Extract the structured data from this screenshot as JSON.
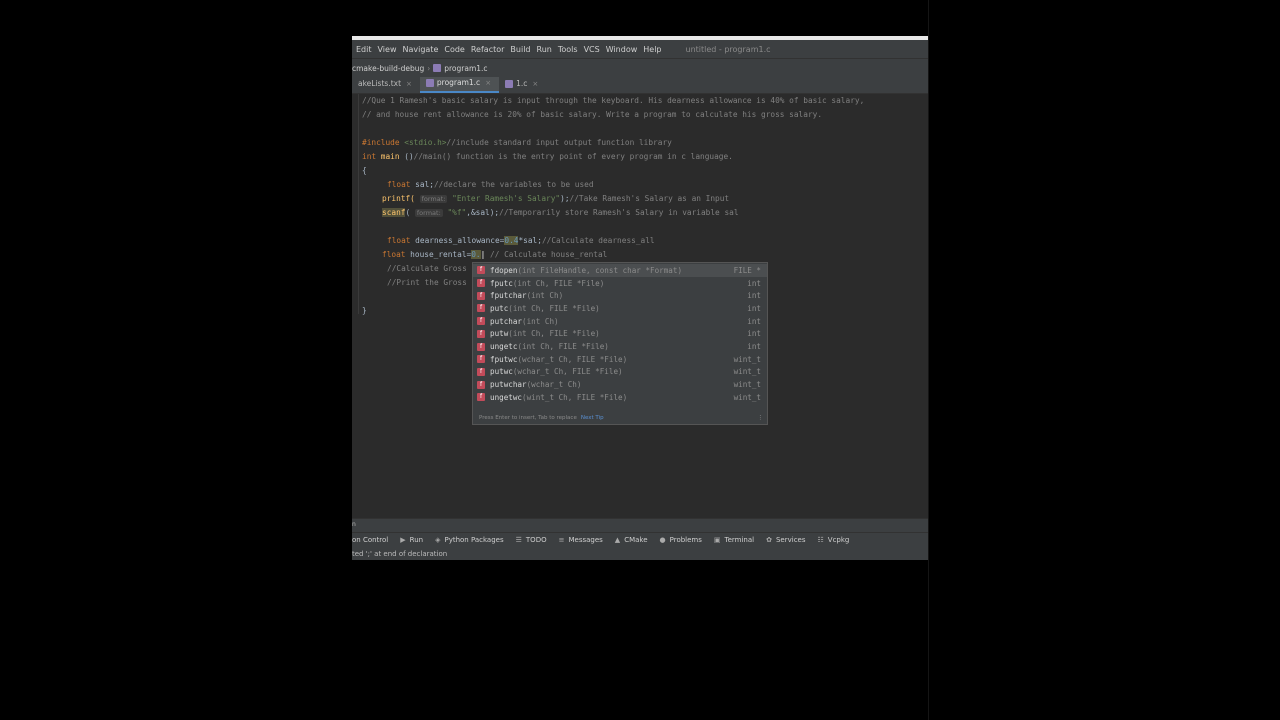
{
  "menubar": {
    "items": [
      "Edit",
      "View",
      "Navigate",
      "Code",
      "Refactor",
      "Build",
      "Run",
      "Tools",
      "VCS",
      "Window",
      "Help"
    ],
    "title": "untitled - program1.c"
  },
  "navbar": {
    "crumb1": "cmake-build-debug",
    "crumb2": "program1.c"
  },
  "tabs": [
    "akeLists.txt",
    "program1.c",
    "1.c"
  ],
  "code": {
    "l1": "//Que 1 Ramesh's basic salary is input through the keyboard. His dearness allowance is 40% of basic salary,",
    "l2": "// and house rent allowance is 20% of basic salary. Write a program to calculate his gross salary.",
    "l3_inc": "#include",
    "l3_hdr": " <stdio.h>",
    "l3_cm": "//include standard input output function library",
    "l4_kw": "int",
    "l4_fn": " main",
    "l4_paren": " ()",
    "l4_cm": "//main() function is the entry point of every program in c language.",
    "l5": "{",
    "l6_kw": "float",
    "l6_var": " sal;",
    "l6_cm": "//declare the variables to be used",
    "l7_fn": "printf(",
    "l7_hint": "format:",
    "l7_str": " \"Enter Ramesh's Salary\"",
    "l7_end": ");",
    "l7_cm": "//Take Ramesh's Salary as an Input",
    "l8_fn": "scanf",
    "l8_paren": "(",
    "l8_hint": "format:",
    "l8_str": " \"%f\"",
    "l8_end": ",&sal);",
    "l8_cm": "//Temporarily store Ramesh's Salary in variable sal",
    "l9_kw": "float",
    "l9_var": " dearness_allowance=",
    "l9_num": "0.4",
    "l9_rest": "*sal;",
    "l9_cm": "//Calculate dearness_all",
    "l10_kw": "float",
    "l10_var": " house_rental=",
    "l10_num": "0.",
    "l10_cm": "// Calculate house_rental",
    "l11": "//Calculate Gross",
    "l12": "//Print the Gross",
    "l13": "}"
  },
  "popup": {
    "items": [
      {
        "name": "fdopen",
        "params": "(int FileHandle, const char *Format)",
        "ret": "FILE *"
      },
      {
        "name": "fputc",
        "params": "(int Ch, FILE *File)",
        "ret": "int"
      },
      {
        "name": "fputchar",
        "params": "(int Ch)",
        "ret": "int"
      },
      {
        "name": "putc",
        "params": "(int Ch, FILE *File)",
        "ret": "int"
      },
      {
        "name": "putchar",
        "params": "(int Ch)",
        "ret": "int"
      },
      {
        "name": "putw",
        "params": "(int Ch, FILE *File)",
        "ret": "int"
      },
      {
        "name": "ungetc",
        "params": "(int Ch, FILE *File)",
        "ret": "int"
      },
      {
        "name": "fputwc",
        "params": "(wchar_t Ch, FILE *File)",
        "ret": "wint_t"
      },
      {
        "name": "putwc",
        "params": "(wchar_t Ch, FILE *File)",
        "ret": "wint_t"
      },
      {
        "name": "putwchar",
        "params": "(wchar_t Ch)",
        "ret": "wint_t"
      },
      {
        "name": "ungetwc",
        "params": "(wint_t Ch, FILE *File)",
        "ret": "wint_t"
      }
    ],
    "icon_letter": "f",
    "footer": "Press Enter to insert, Tab to replace",
    "footer_link": "Next Tip"
  },
  "bottom": {
    "small_left": "n",
    "tools": [
      "on Control",
      "Run",
      "Python Packages",
      "TODO",
      "Messages",
      "CMake",
      "Problems",
      "Terminal",
      "Services",
      "Vcpkg"
    ],
    "status": "ted ';' at end of declaration"
  },
  "colors": {
    "editor_bg": "#2b2b2b",
    "keyword": "#cc7832",
    "string": "#6a8759",
    "comment": "#808080",
    "function": "#ffc66d"
  }
}
